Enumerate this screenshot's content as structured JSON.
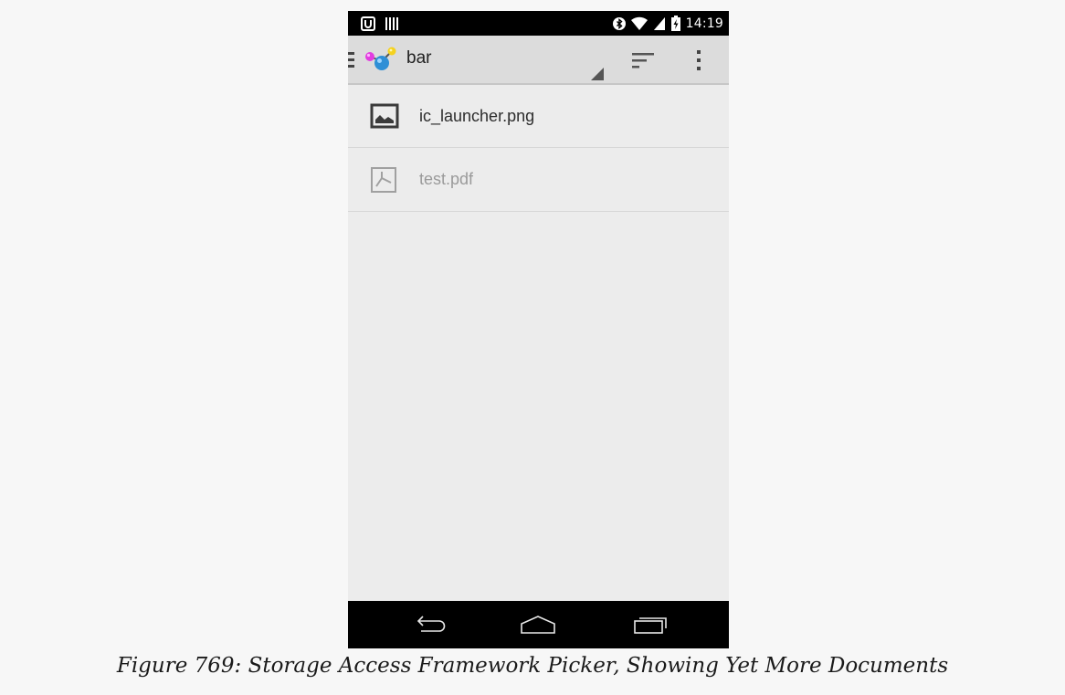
{
  "status_bar": {
    "time": "14:19",
    "icons": [
      "notification-icon",
      "barcode-icon",
      "bluetooth-icon",
      "wifi-icon",
      "signal-icon",
      "battery-charging-icon"
    ]
  },
  "action_bar": {
    "title": "bar",
    "icons": [
      "drawer-icon",
      "app-logo-icon",
      "spinner-arrow-icon",
      "sort-icon",
      "overflow-menu-icon"
    ]
  },
  "files": [
    {
      "name": "ic_launcher.png",
      "icon": "image-file-icon",
      "enabled": true
    },
    {
      "name": "test.pdf",
      "icon": "pdf-file-icon",
      "enabled": false
    }
  ],
  "nav_bar": {
    "icons": [
      "back-icon",
      "home-icon",
      "recents-icon"
    ]
  },
  "caption": "Figure 769: Storage Access Framework Picker, Showing Yet More Documents",
  "colors": {
    "action_bar_bg": "#dcdcdc",
    "list_bg": "#ececec",
    "bar_bg": "#000000",
    "page_bg": "#f7f7f7"
  }
}
